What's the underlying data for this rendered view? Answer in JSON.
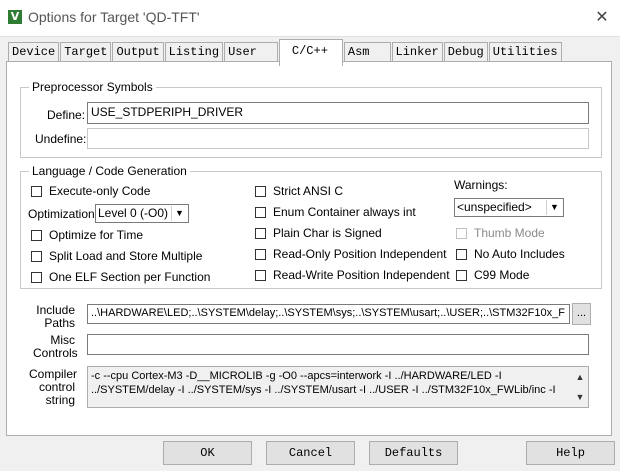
{
  "window": {
    "title": "Options for Target 'QD-TFT'",
    "icon_letter": "V",
    "close_glyph": "✕"
  },
  "tabs": [
    {
      "label": "Device"
    },
    {
      "label": "Target"
    },
    {
      "label": "Output"
    },
    {
      "label": "Listing"
    },
    {
      "label": "User"
    },
    {
      "label": "C/C++",
      "active": true
    },
    {
      "label": "Asm"
    },
    {
      "label": "Linker"
    },
    {
      "label": "Debug"
    },
    {
      "label": "Utilities"
    }
  ],
  "preprocessor": {
    "group_label": "Preprocessor Symbols",
    "define_label": "Define:",
    "define_value": "USE_STDPERIPH_DRIVER",
    "undefine_label": "Undefine:",
    "undefine_value": ""
  },
  "language": {
    "group_label": "Language / Code Generation",
    "execute_only": "Execute-only Code",
    "optimization_label": "Optimization:",
    "optimization_value": "Level 0 (-O0)",
    "optimize_time": "Optimize for Time",
    "split_load": "Split Load and Store Multiple",
    "one_elf": "One ELF Section per Function",
    "strict_ansi": "Strict ANSI C",
    "enum_container": "Enum Container always int",
    "plain_char": "Plain Char is Signed",
    "ro_pi": "Read-Only Position Independent",
    "rw_pi": "Read-Write Position Independent",
    "warnings_label": "Warnings:",
    "warnings_value": "<unspecified>",
    "thumb_mode": "Thumb Mode",
    "no_auto_includes": "No Auto Includes",
    "c99_mode": "C99 Mode"
  },
  "include": {
    "label_line1": "Include",
    "label_line2": "Paths",
    "value": "..\\HARDWARE\\LED;..\\SYSTEM\\delay;..\\SYSTEM\\sys;..\\SYSTEM\\usart;..\\USER;..\\STM32F10x_F",
    "browse_label": "..."
  },
  "misc": {
    "label_line1": "Misc",
    "label_line2": "Controls",
    "value": ""
  },
  "compiler": {
    "label_line1": "Compiler",
    "label_line2": "control",
    "label_line3": "string",
    "line1": "-c --cpu Cortex-M3 -D__MICROLIB -g -O0 --apcs=interwork -I ../HARDWARE/LED -I",
    "line2": "../SYSTEM/delay -I ../SYSTEM/sys -I ../SYSTEM/usart -I ../USER -I ../STM32F10x_FWLib/inc -I",
    "scroll_up": "▲",
    "scroll_down": "▼"
  },
  "buttons": {
    "ok": "OK",
    "cancel": "Cancel",
    "defaults": "Defaults",
    "help": "Help"
  }
}
